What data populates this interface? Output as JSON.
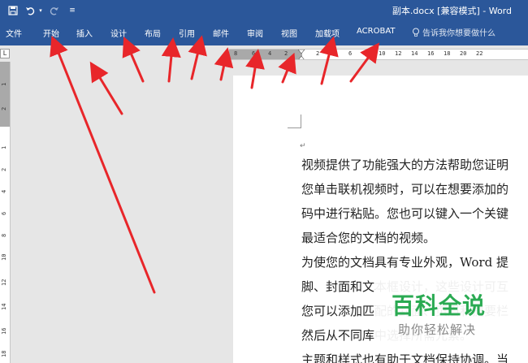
{
  "titlebar": {
    "title": "副本.docx [兼容模式] - Word",
    "icons": [
      "save-icon",
      "undo-icon",
      "undo-dropdown-icon",
      "redo-icon",
      "customize-quick-access-icon"
    ]
  },
  "ribbon": {
    "tabs": [
      "文件",
      "开始",
      "插入",
      "设计",
      "布局",
      "引用",
      "邮件",
      "审阅",
      "视图",
      "加载项",
      "ACROBAT"
    ],
    "tell_me": "告诉我你想要做什么"
  },
  "ruler": {
    "corner": "L",
    "horizontal_numbers": [
      "8",
      "6",
      "4",
      "2",
      "2",
      "4",
      "6",
      "8",
      "10",
      "12",
      "14",
      "16",
      "18",
      "20",
      "22"
    ],
    "vertical_numbers": [
      "1",
      "2",
      "1",
      "2",
      "4",
      "6",
      "8",
      "10",
      "12",
      "14",
      "16",
      "18"
    ]
  },
  "document": {
    "lines": [
      "视频提供了功能强大的方法帮助您证明",
      "您单击联机视频时，可以在想要添加的",
      "码中进行粘贴。您也可以键入一个关键",
      "最适合您的文档的视频。",
      "为使您的文档具有专业外观，Word 提",
      "脚、封面和文本框设计，这些设计可互",
      "您可以添加匹配的封面、页眉和提要栏",
      "然后从不同库中选择所需元素。",
      "主题和样式也有助于文档保持协调。当"
    ]
  },
  "watermark": {
    "title": "百科全说",
    "subtitle": "助你轻松解决"
  },
  "colors": {
    "ribbon": "#2b579a",
    "arrow": "#e8262a",
    "watermark_green": "#2aaa52"
  }
}
